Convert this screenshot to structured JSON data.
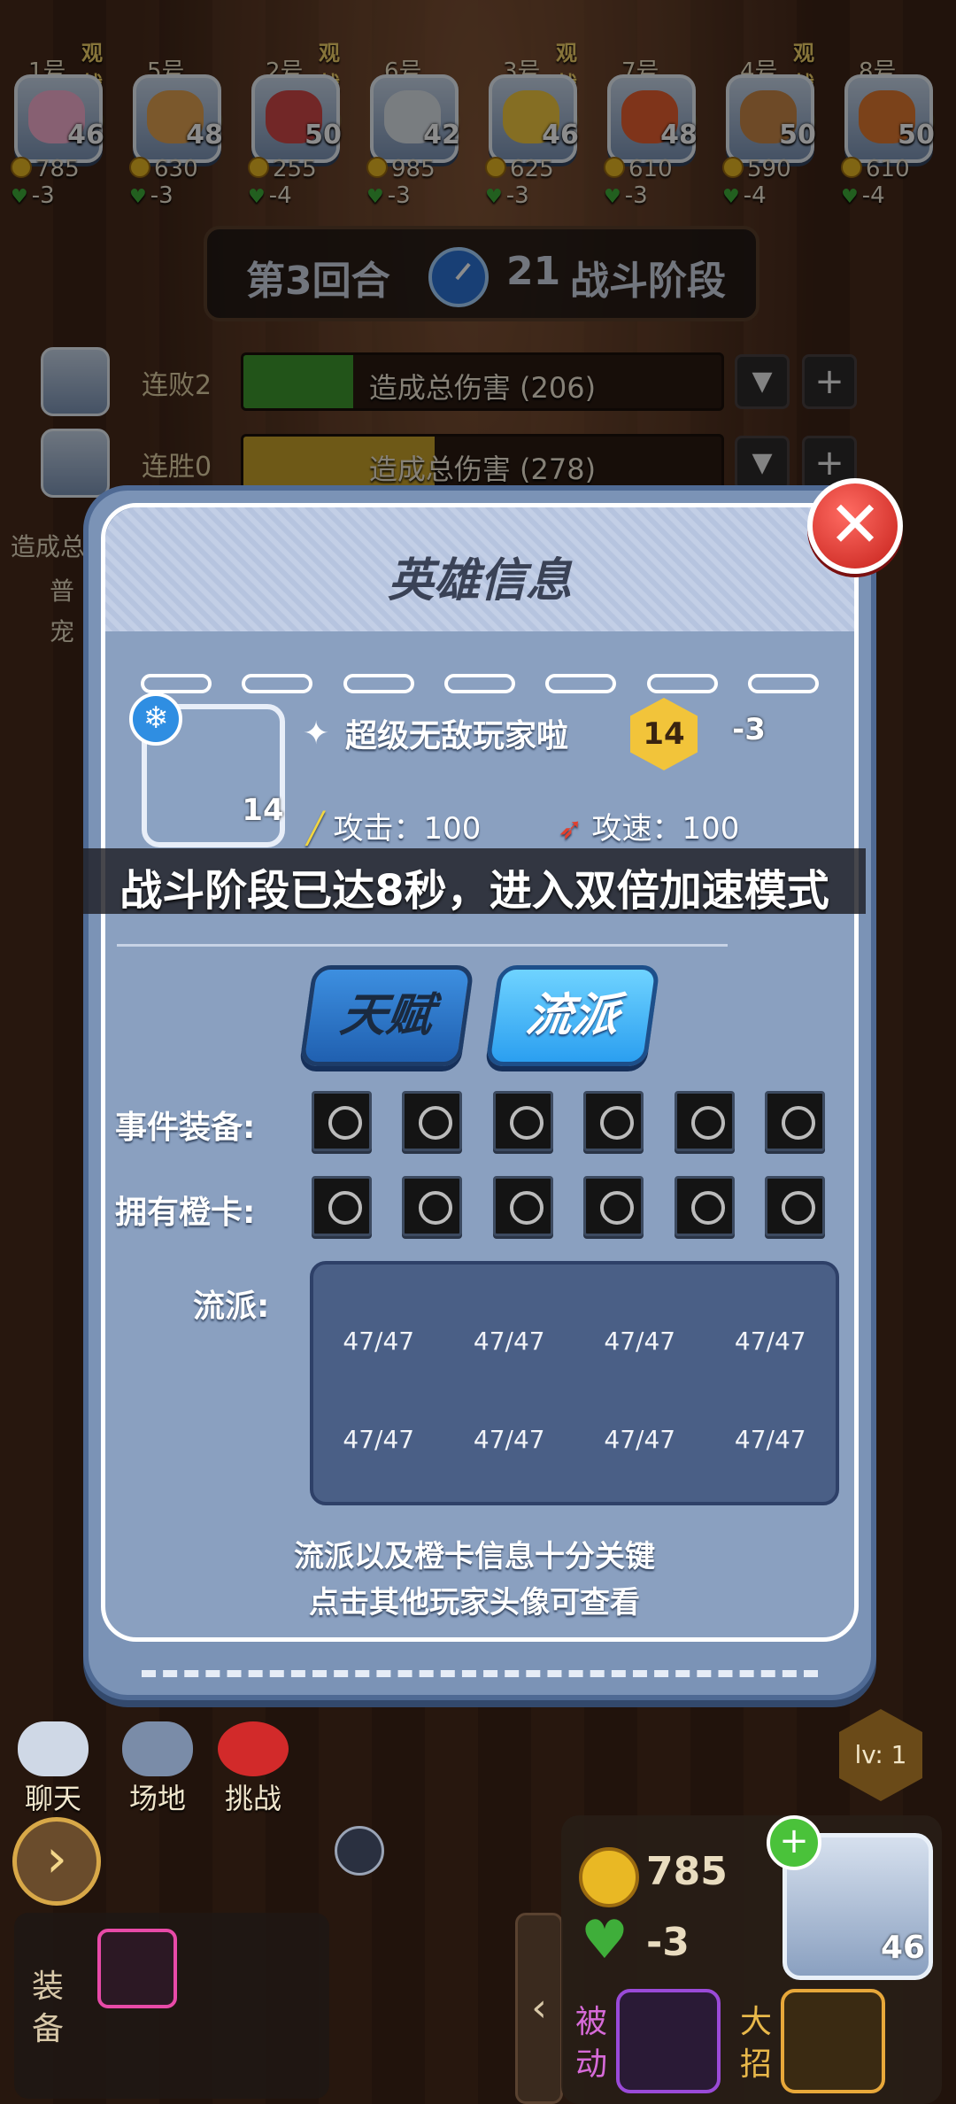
{
  "players": [
    {
      "num": "1号",
      "watch": "观战",
      "hp": "46",
      "gold": "785",
      "streak": "-3",
      "face": "#f6b0d0"
    },
    {
      "num": "5号",
      "watch": "",
      "hp": "48",
      "gold": "630",
      "streak": "-3",
      "face": "#e0a050"
    },
    {
      "num": "2号",
      "watch": "观战",
      "hp": "50",
      "gold": "255",
      "streak": "-4",
      "face": "#d04848"
    },
    {
      "num": "6号",
      "watch": "",
      "hp": "42",
      "gold": "985",
      "streak": "-3",
      "face": "#dde3ea"
    },
    {
      "num": "3号",
      "watch": "观战",
      "hp": "46",
      "gold": "625",
      "streak": "-3",
      "face": "#f2c840"
    },
    {
      "num": "7号",
      "watch": "",
      "hp": "48",
      "gold": "610",
      "streak": "-3",
      "face": "#e86030"
    },
    {
      "num": "4号",
      "watch": "观战",
      "hp": "50",
      "gold": "590",
      "streak": "-4",
      "face": "#c88848"
    },
    {
      "num": "8号",
      "watch": "",
      "hp": "50",
      "gold": "610",
      "streak": "-4",
      "face": "#e07830"
    }
  ],
  "round": {
    "round_text": "第3回合",
    "timer": "21",
    "phase": "战斗阶段"
  },
  "damage_rows": [
    {
      "label": "连败2",
      "bar_text": "造成总伤害 (206)",
      "fill_fraction": 0.23,
      "fill_color": "#3e9a2e"
    },
    {
      "label": "连胜0",
      "bar_text": "造成总伤害 (278)",
      "fill_fraction": 0.4,
      "fill_color": "#c9a22a"
    }
  ],
  "side": {
    "label": "造成总",
    "item1": "普",
    "item2": "宠"
  },
  "modal": {
    "title": "英雄信息",
    "close": "✕",
    "hero_name": "超级无敌玩家啦",
    "level_badge": "14",
    "streak_badge": "-3",
    "hp_badge": "14",
    "attack": "攻击：100",
    "attack_speed": "攻速：100",
    "tab_talent": "天赋",
    "tab_school": "流派",
    "event_equip_label": "事件装备:",
    "orange_card_label": "拥有橙卡:",
    "school_label": "流派:",
    "school_values": [
      "47/47",
      "47/47",
      "47/47",
      "47/47",
      "47/47",
      "47/47",
      "47/47",
      "47/47"
    ],
    "hint_line1": "流派以及橙卡信息十分关键",
    "hint_line2": "点击其他玩家头像可查看"
  },
  "toast": "战斗阶段已达8秒，进入双倍加速模式",
  "hud": {
    "chat": "聊天",
    "arena": "场地",
    "challenge": "挑战",
    "arrow": "›",
    "equip_label": "装备",
    "collapse": "‹",
    "level": "lv: 1",
    "my_gold": "785",
    "my_streak": "-3",
    "my_hp": "46",
    "plus": "+",
    "passive": "被动",
    "ultimate": "大招"
  },
  "colors": {
    "accent_blue": "#2b9ff0",
    "gold": "#e9b824",
    "green": "#3fae3a",
    "red": "#e2262e"
  }
}
